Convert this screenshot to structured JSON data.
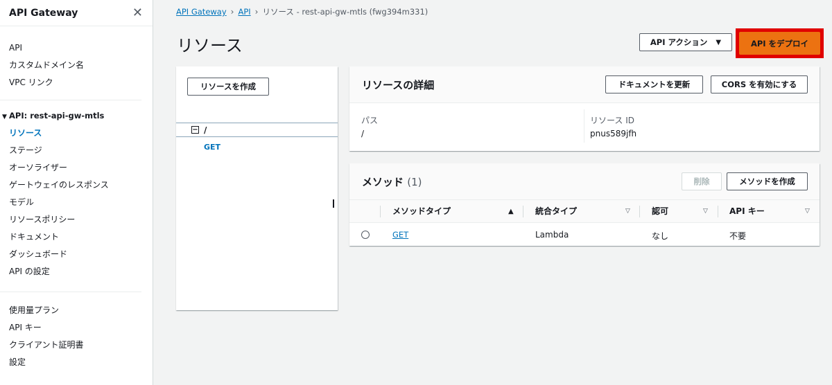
{
  "sidebar": {
    "title": "API Gateway",
    "top_items": [
      {
        "label": "API"
      },
      {
        "label": "カスタムドメイン名"
      },
      {
        "label": "VPC リンク"
      }
    ],
    "api_section_title": "API: rest-api-gw-mtls",
    "api_items": [
      {
        "label": "リソース",
        "active": true
      },
      {
        "label": "ステージ"
      },
      {
        "label": "オーソライザー"
      },
      {
        "label": "ゲートウェイのレスポンス"
      },
      {
        "label": "モデル"
      },
      {
        "label": "リソースポリシー"
      },
      {
        "label": "ドキュメント"
      },
      {
        "label": "ダッシュボード"
      },
      {
        "label": "API の設定"
      }
    ],
    "bottom_items": [
      {
        "label": "使用量プラン"
      },
      {
        "label": "API キー"
      },
      {
        "label": "クライアント証明書"
      },
      {
        "label": "設定"
      }
    ]
  },
  "breadcrumb": {
    "items": [
      "API Gateway",
      "API"
    ],
    "current": "リソース - rest-api-gw-mtls (fwg394m331)"
  },
  "page": {
    "title": "リソース",
    "api_actions_label": "API アクション",
    "deploy_label": "API をデプロイ",
    "accent_color": "#ec7211",
    "highlight_color": "#e00000"
  },
  "tree": {
    "create_resource_label": "リソースを作成",
    "root_path": "/",
    "methods": [
      "GET"
    ]
  },
  "details": {
    "title": "リソースの詳細",
    "update_docs_label": "ドキュメントを更新",
    "enable_cors_label": "CORS を有効にする",
    "path_label": "パス",
    "path_value": "/",
    "resource_id_label": "リソース ID",
    "resource_id_value": "pnus589jfh"
  },
  "methods": {
    "title": "メソッド",
    "count": "(1)",
    "delete_label": "削除",
    "create_method_label": "メソッドを作成",
    "columns": [
      "メソッドタイプ",
      "統合タイプ",
      "認可",
      "API キー"
    ],
    "rows": [
      {
        "method": "GET",
        "integration": "Lambda",
        "auth": "なし",
        "api_key": "不要"
      }
    ]
  }
}
